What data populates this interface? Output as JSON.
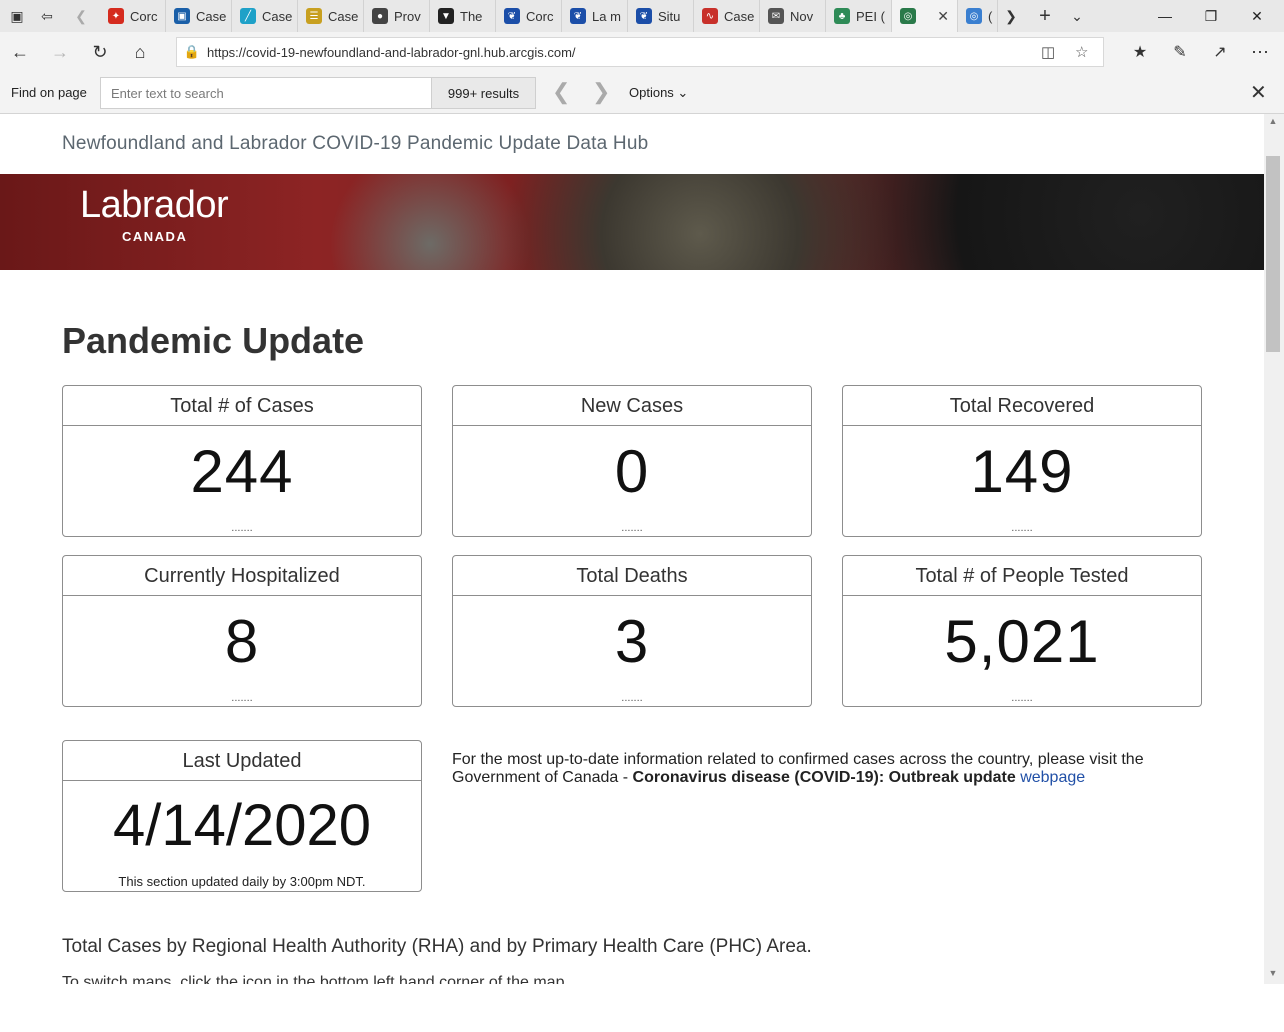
{
  "browser": {
    "tabs": [
      {
        "label": "Corc",
        "icon": "maple-leaf-icon",
        "color": "#d52b1e"
      },
      {
        "label": "Case",
        "icon": "news-icon",
        "color": "#1a5fa8"
      },
      {
        "label": "Case",
        "icon": "chart-icon",
        "color": "#1ea1c8"
      },
      {
        "label": "Case",
        "icon": "document-icon",
        "color": "#c8a020"
      },
      {
        "label": "Prov",
        "icon": "bison-icon",
        "color": "#444444"
      },
      {
        "label": "The",
        "icon": "shield-icon",
        "color": "#222222"
      },
      {
        "label": "Corc",
        "icon": "fleur-de-lis-icon",
        "color": "#1b4ea8"
      },
      {
        "label": "La m",
        "icon": "fleur-de-lis-icon",
        "color": "#1b4ea8"
      },
      {
        "label": "Situ",
        "icon": "fleur-de-lis-icon",
        "color": "#1b4ea8"
      },
      {
        "label": "Case",
        "icon": "curve-icon",
        "color": "#c8302a"
      },
      {
        "label": "Nov",
        "icon": "mail-icon",
        "color": "#555555"
      },
      {
        "label": "PEI (",
        "icon": "tree-icon",
        "color": "#2e8b57"
      },
      {
        "label": "",
        "icon": "globe-icon",
        "color": "#2a7a4a",
        "active": true
      },
      {
        "label": "(",
        "icon": "globe-blue-icon",
        "color": "#3a7fd0"
      }
    ],
    "url": "https://covid-19-newfoundland-and-labrador-gnl.hub.arcgis.com/"
  },
  "findbar": {
    "label": "Find on page",
    "placeholder": "Enter text to search",
    "results": "999+ results",
    "options": "Options"
  },
  "site": {
    "title": "Newfoundland and Labrador COVID-19 Pandemic Update Data Hub",
    "banner_logo": "Labrador",
    "banner_country": "CANADA"
  },
  "main": {
    "heading": "Pandemic Update",
    "cards": [
      {
        "title": "Total # of Cases",
        "value": "244",
        "dots": "......."
      },
      {
        "title": "New Cases",
        "value": "0",
        "dots": "......."
      },
      {
        "title": "Total Recovered",
        "value": "149",
        "dots": "......."
      },
      {
        "title": "Currently Hospitalized",
        "value": "8",
        "dots": "......."
      },
      {
        "title": "Total Deaths",
        "value": "3",
        "dots": "......."
      },
      {
        "title": "Total # of People Tested",
        "value": "5,021",
        "dots": "......."
      }
    ],
    "last_updated": {
      "title": "Last Updated",
      "date": "4/14/2020",
      "note": "This section updated daily by 3:00pm NDT."
    },
    "info": {
      "text": "For the most up-to-date information related to confirmed cases across the country, please visit the Government of Canada - ",
      "strong": "Coronavirus disease (COVID-19): Outbreak update",
      "link": "webpage"
    },
    "section_title": "Total Cases by Regional Health Authority (RHA) and by Primary Health Care (PHC) Area.",
    "section_sub": "To switch maps, click the icon in the bottom left hand corner of the map."
  }
}
